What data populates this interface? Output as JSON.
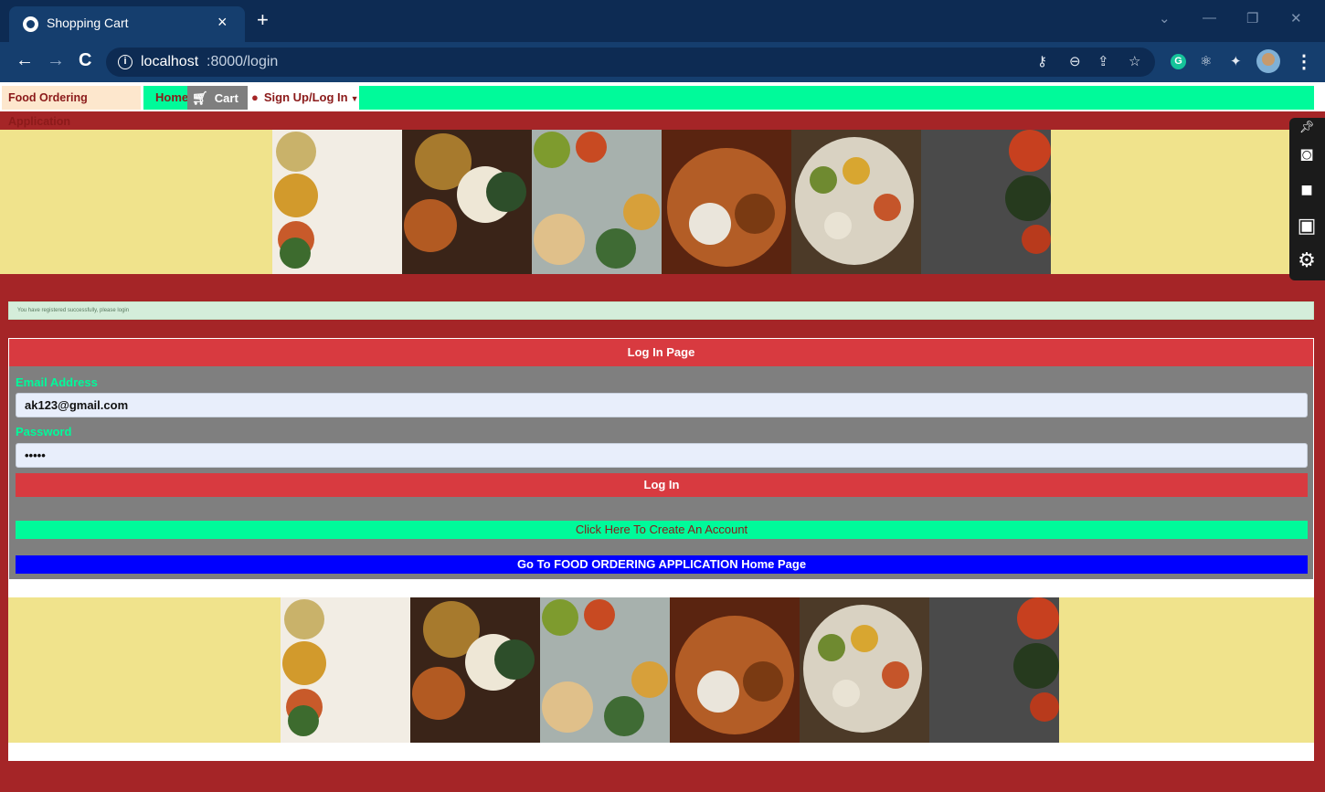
{
  "browser": {
    "tab_title": "Shopping Cart",
    "url_host": "localhost",
    "url_path": ":8000/login"
  },
  "nav": {
    "brand": "Food Ordering Application",
    "home": "Home",
    "cart": "Cart",
    "login_menu": "Sign Up/Log In"
  },
  "alert": {
    "message": "You have registered successfully, please login"
  },
  "login": {
    "heading": "Log In Page",
    "email_label": "Email Address",
    "email_value": "ak123@gmail.com",
    "password_label": "Password",
    "password_value": "•••••",
    "login_button": "Log In",
    "create_account_button": "Click Here To Create An Account",
    "home_page_button": "Go To FOOD ORDERING APPLICATION Home Page"
  },
  "colors": {
    "page_bg": "#a52527",
    "accent_green": "#00fa9a",
    "header_red": "#d83a40",
    "home_blue": "#0000ff",
    "banner_yellow": "#f0e38c"
  }
}
